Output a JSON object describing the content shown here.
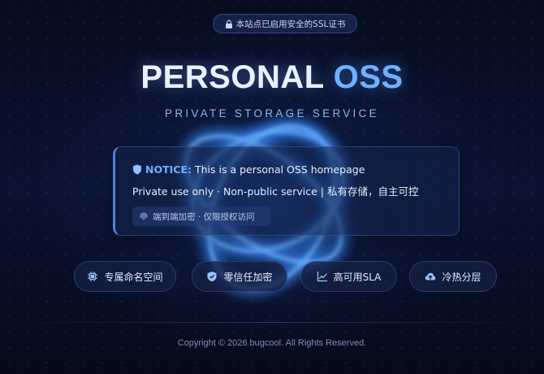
{
  "ssl_badge": {
    "text": "本站点已启用安全的SSL证书",
    "icon": "lock-icon"
  },
  "hero": {
    "title_part1": "PERSONAL",
    "title_part2": "OSS",
    "subtitle": "PRIVATE STORAGE SERVICE"
  },
  "notice": {
    "label": "NOTICE:",
    "line1": "This is a personal OSS homepage",
    "line2": "Private use only · Non-public service | 私有存储，自主可控",
    "tag": "端到端加密 · 仅限授权访问",
    "icon": "shield-icon",
    "tag_icon": "fingerprint-icon"
  },
  "features": [
    {
      "label": "专属命名空间",
      "icon": "chip-icon"
    },
    {
      "label": "零信任加密",
      "icon": "shield-check-icon"
    },
    {
      "label": "高可用SLA",
      "icon": "chart-line-icon"
    },
    {
      "label": "冷热分层",
      "icon": "cloud-upload-icon"
    }
  ],
  "footer": {
    "copyright": "Copyright © 2026 bugcool. All Rights Reserved."
  },
  "colors": {
    "background": "#060b1c",
    "accent": "#6fb0ff",
    "text": "#e6eeff"
  }
}
